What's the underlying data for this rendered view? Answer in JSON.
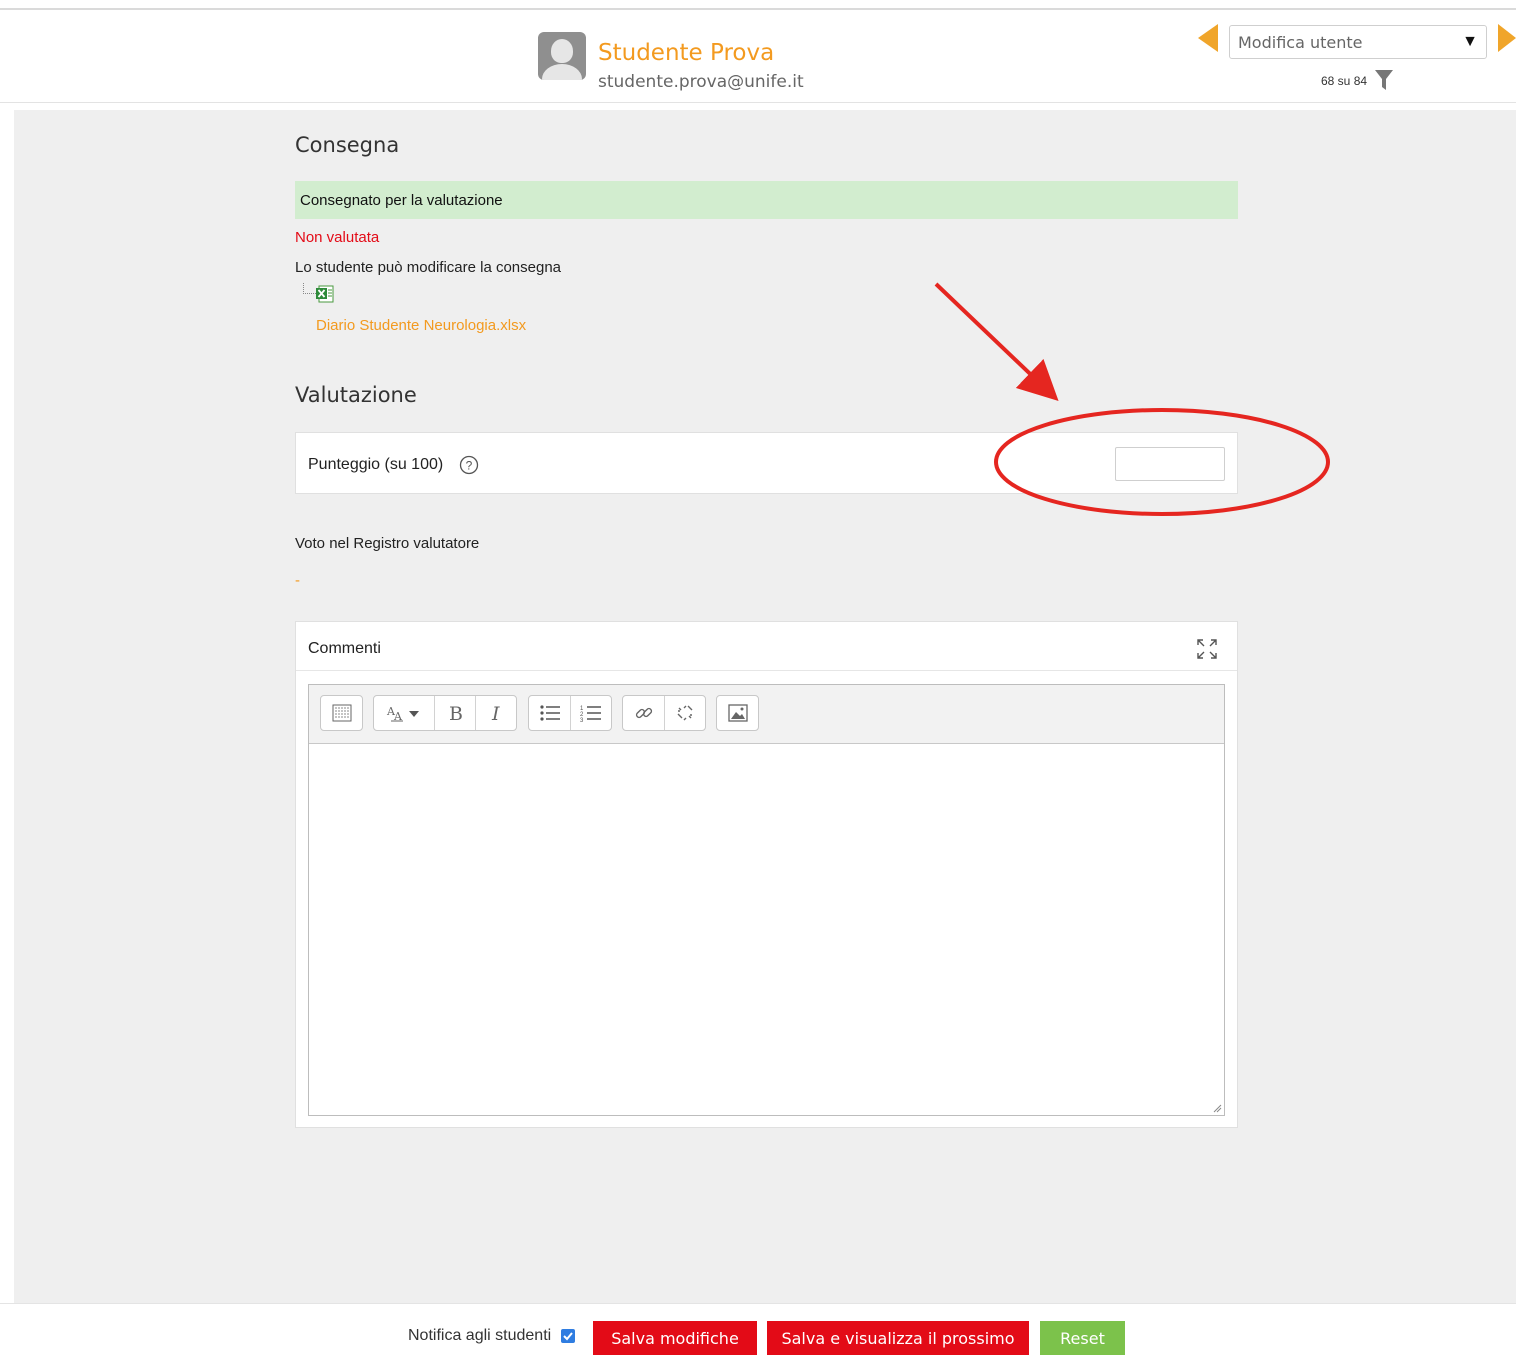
{
  "header": {
    "user_name": "Studente Prova",
    "user_email": "studente.prova@unife.it",
    "user_select": {
      "selected": "Modifica utente"
    },
    "counter": "68 su 84"
  },
  "submission": {
    "heading": "Consegna",
    "status": "Consegnato per la valutazione",
    "grading_status": "Non valutata",
    "can_edit_note": "Lo studente può modificare la consegna",
    "file": {
      "name": "Diario Studente Neurologia.xlsx",
      "icon": "excel-file-icon"
    }
  },
  "grade": {
    "heading": "Valutazione",
    "score_label": "Punteggio (su 100)",
    "score_value": "",
    "gradebook_label": "Voto nel Registro valutatore",
    "gradebook_value": "-"
  },
  "comments": {
    "label": "Commenti",
    "text": "",
    "toolbar": [
      "toolbar-toggle-icon",
      "font-style-icon",
      "bold-icon",
      "italic-icon",
      "unordered-list-icon",
      "ordered-list-icon",
      "link-icon",
      "unlink-icon",
      "image-icon"
    ]
  },
  "footer": {
    "notify_label": "Notifica agli studenti",
    "notify_checked": true,
    "save_label": "Salva modifiche",
    "save_next_label": "Salva e visualizza il prossimo",
    "reset_label": "Reset"
  },
  "colors": {
    "accent_orange": "#f39a1f",
    "danger_red": "#e30b17",
    "success_green": "#7cc24b",
    "submitted_bg": "#d2edcf",
    "annotation_red": "#e52620"
  }
}
